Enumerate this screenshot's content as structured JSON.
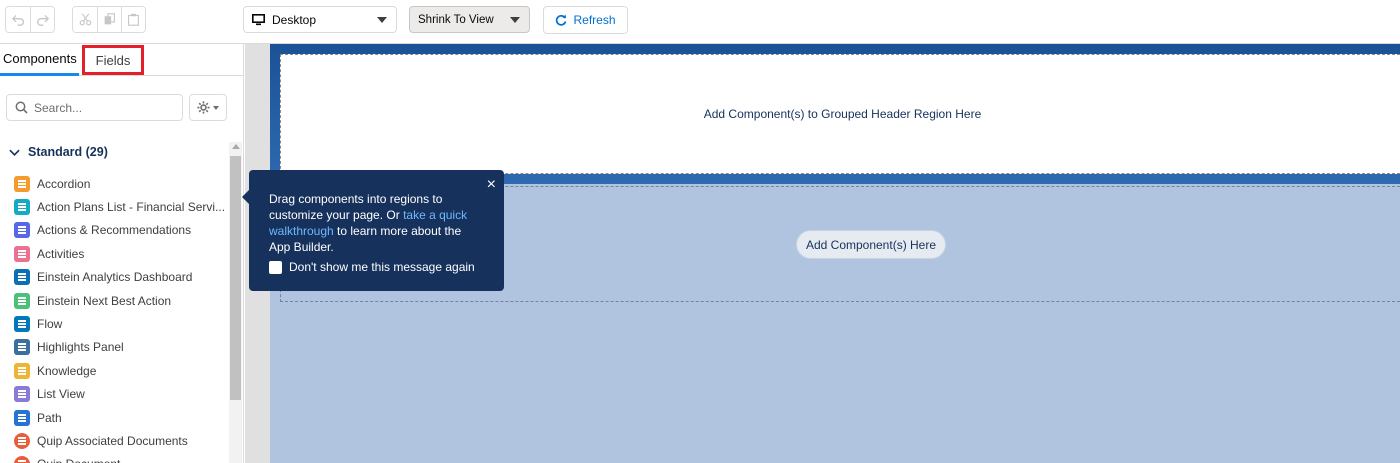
{
  "toolbar": {
    "device_select": "Desktop",
    "zoom_select": "Shrink To View",
    "refresh_label": "Refresh",
    "icons": [
      "undo-icon",
      "redo-icon",
      "cut-icon",
      "copy-icon",
      "paste-icon"
    ]
  },
  "left_panel": {
    "tabs": [
      {
        "label": "Components",
        "active": true
      },
      {
        "label": "Fields",
        "active": false,
        "highlighted": true
      }
    ],
    "search_placeholder": "Search...",
    "section": "Standard (29)",
    "components": [
      {
        "label": "Accordion",
        "color": "#f59b2e"
      },
      {
        "label": "Action Plans List - Financial Servi...",
        "color": "#16a9c4"
      },
      {
        "label": "Actions & Recommendations",
        "color": "#5867e8"
      },
      {
        "label": "Activities",
        "color": "#eb7092"
      },
      {
        "label": "Einstein Analytics Dashboard",
        "color": "#0b6fb8"
      },
      {
        "label": "Einstein Next Best Action",
        "color": "#4bc076"
      },
      {
        "label": "Flow",
        "color": "#0079bc"
      },
      {
        "label": "Highlights Panel",
        "color": "#3b6fa0"
      },
      {
        "label": "Knowledge",
        "color": "#ecb534"
      },
      {
        "label": "List View",
        "color": "#8b7bd8"
      },
      {
        "label": "Path",
        "color": "#2574d4"
      },
      {
        "label": "Quip Associated Documents",
        "color": "#e85e3b"
      },
      {
        "label": "Quip Document",
        "color": "#e85e3b"
      }
    ]
  },
  "canvas": {
    "header_region": "Add Component(s) to Grouped Header Region Here",
    "add_button": "Add Component(s) Here"
  },
  "popover": {
    "text_before": "Drag components into regions to customize your page. Or ",
    "link": "take a quick walkthrough",
    "text_after": " to learn more about the App Builder.",
    "checkbox_label": "Don't show me this message again",
    "close": "×"
  }
}
